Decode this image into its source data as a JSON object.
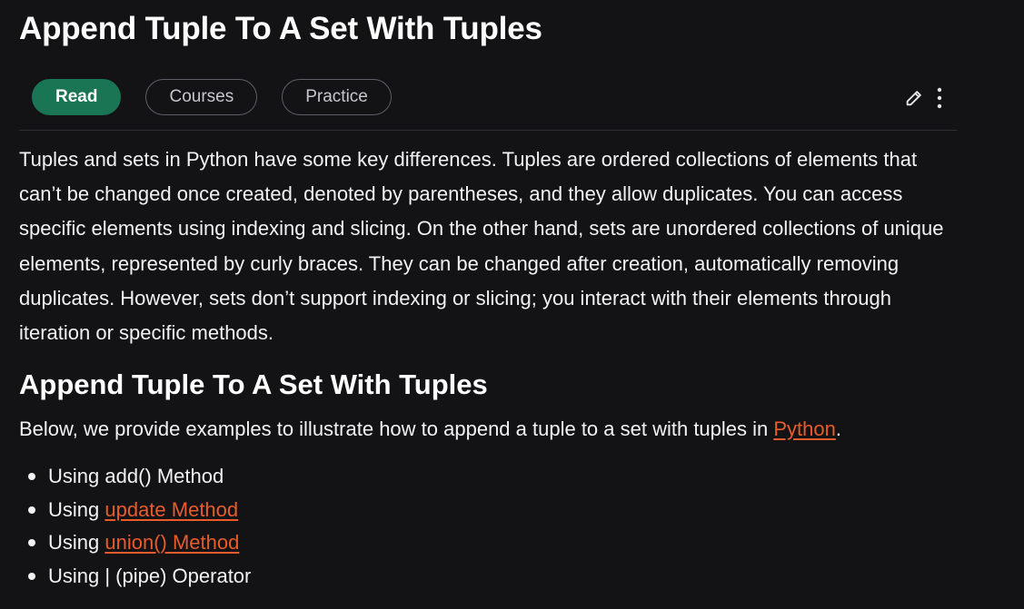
{
  "article": {
    "title": "Append Tuple To A Set With Tuples",
    "tabs": [
      {
        "label": "Read",
        "active": true
      },
      {
        "label": "Courses",
        "active": false
      },
      {
        "label": "Practice",
        "active": false
      }
    ],
    "actions": {
      "edit_icon": "pencil-icon",
      "more_icon": "kebab-menu-icon"
    },
    "intro": "Tuples and sets in Python have some key differences. Tuples are ordered collections of elements that can’t be changed once created, denoted by parentheses, and they allow duplicates. You can access specific elements using indexing and slicing. On the other hand, sets are unordered collections of unique elements, represented by curly braces. They can be changed after creation, automatically removing duplicates. However, sets don’t support indexing or slicing; you interact with their elements through iteration or specific methods.",
    "section": {
      "heading": "Append Tuple To A Set With Tuples",
      "below_prefix": "Below, we provide examples to illustrate how to append a tuple to a set with tuples in ",
      "below_link": "Python",
      "below_suffix": ".",
      "methods": [
        {
          "text": "Using add() Method",
          "prefix": "",
          "link": ""
        },
        {
          "text": "",
          "prefix": "Using ",
          "link": "update Method"
        },
        {
          "text": "",
          "prefix": "Using ",
          "link": "union() Method"
        },
        {
          "text": "Using | (pipe) Operator",
          "prefix": "",
          "link": ""
        }
      ]
    }
  },
  "colors": {
    "background": "#131316",
    "accent_green": "#1a7554",
    "link_orange": "#e85c2b",
    "text": "#f2f2f2"
  }
}
